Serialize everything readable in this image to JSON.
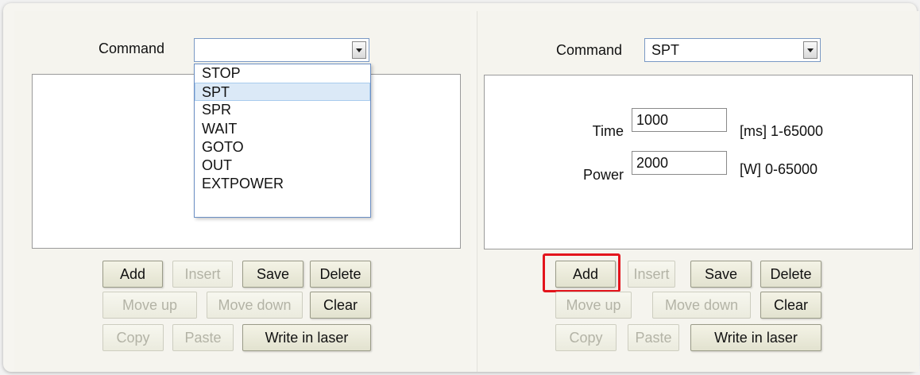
{
  "left": {
    "command_label": "Command",
    "command_value": "",
    "dropdown_options": [
      "STOP",
      "SPT",
      "SPR",
      "WAIT",
      "GOTO",
      "OUT",
      "EXTPOWER"
    ],
    "dropdown_hovered": "SPT",
    "buttons": {
      "add": "Add",
      "insert": "Insert",
      "save": "Save",
      "delete": "Delete",
      "move_up": "Move up",
      "move_down": "Move down",
      "clear": "Clear",
      "copy": "Copy",
      "paste": "Paste",
      "write_in_laser": "Write in laser"
    }
  },
  "right": {
    "command_label": "Command",
    "command_value": "SPT",
    "time_label": "Time",
    "time_value": "1000",
    "time_unit": "[ms] 1-65000",
    "power_label": "Power",
    "power_value": "2000",
    "power_unit": "[W] 0-65000",
    "buttons": {
      "add": "Add",
      "insert": "Insert",
      "save": "Save",
      "delete": "Delete",
      "move_up": "Move up",
      "move_down": "Move down",
      "clear": "Clear",
      "copy": "Copy",
      "paste": "Paste",
      "write_in_laser": "Write in laser"
    }
  },
  "colors": {
    "highlight": "#e3141c",
    "dropdown_selected": "#dbe9f7"
  }
}
